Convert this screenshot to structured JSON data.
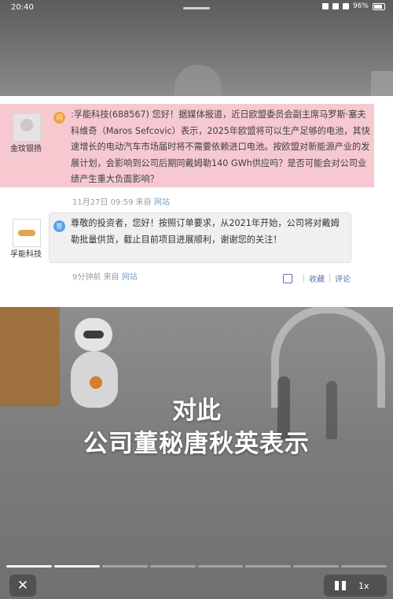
{
  "status_bar": {
    "time": "20:40",
    "battery": "96%"
  },
  "question": {
    "user": "金玟银扬",
    "badge": "问",
    "text": ":孚能科技(688567) 您好！据媒体报道，近日欧盟委员会副主席马罗斯·塞夫科维奇（Maros Sefcovic）表示，2025年欧盟将可以生产足够的电池，其快速增长的电动汽车市场届时将不需要依赖进口电池。按欧盟对新能源产业的发展计划，会影响到公司后期同戴姆勒140 GWh供应吗？是否可能会对公司业绩产生重大负面影响？",
    "date": "11月27日 09:59",
    "from": "来自",
    "site": "网站"
  },
  "answer": {
    "company": "孚能科技",
    "badge": "答",
    "text": "尊敬的投资者，您好！按照订单要求，从2021年开始，公司将对戴姆勒批量供货，截止目前项目进展顺利，谢谢您的关注！",
    "time": "9分钟前",
    "from": "来自",
    "site": "网站"
  },
  "actions": {
    "favorite": "收藏",
    "comment": "评论"
  },
  "captions": {
    "line1": "对此",
    "line2": "公司董秘唐秋英表示"
  },
  "player": {
    "speed": "1x",
    "close_glyph": "✕"
  },
  "colors": {
    "question_bg": "#f6c9d1",
    "answer_bg": "#f0f0f0",
    "link": "#5a76a6",
    "question_badge": "#f0a23a",
    "answer_badge": "#58a2e8"
  },
  "icons": [
    "close-icon",
    "pause-icon",
    "thumbs-up-icon"
  ]
}
